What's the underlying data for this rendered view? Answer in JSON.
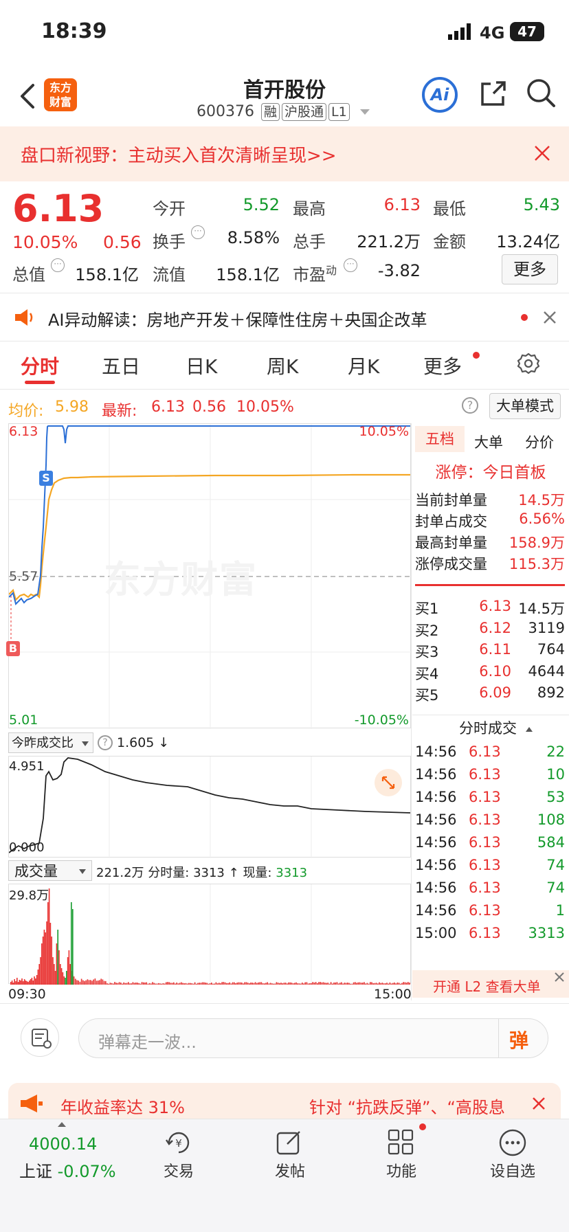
{
  "status_bar": {
    "time": "18:39",
    "network": "4G",
    "battery": "47"
  },
  "header": {
    "title": "首开股份",
    "code": "600376",
    "tags": [
      "融",
      "沪股通",
      "L1"
    ],
    "logo_line1": "东方",
    "logo_line2": "财富",
    "ai_label": "Ai"
  },
  "banner": {
    "text": "盘口新视野：主动买入首次清晰呈现>>"
  },
  "quote": {
    "price": "6.13",
    "pct": "10.05%",
    "change": "0.56",
    "rows": [
      [
        {
          "label": "今开",
          "value": "5.52",
          "color": "green"
        },
        {
          "label": "最高",
          "value": "6.13",
          "color": "red"
        },
        {
          "label": "最低",
          "value": "5.43",
          "color": "green"
        }
      ],
      [
        {
          "label": "换手",
          "value": "8.58%",
          "color": "dark"
        },
        {
          "label": "总手",
          "value": "221.2万",
          "color": "dark"
        },
        {
          "label": "金额",
          "value": "13.24亿",
          "color": "dark"
        }
      ],
      [
        {
          "label": "总值",
          "value": "158.1亿",
          "color": "dark"
        },
        {
          "label": "流值",
          "value": "158.1亿",
          "color": "dark"
        },
        {
          "label": "市盈",
          "sup": "动",
          "value": "-3.82",
          "color": "dark"
        }
      ]
    ],
    "more_button": "更多"
  },
  "ai_news": {
    "text": "AI异动解读：房地产开发＋保障性住房＋央国企改革"
  },
  "tabs": [
    "分时",
    "五日",
    "日K",
    "周K",
    "月K",
    "更多"
  ],
  "chart_header": {
    "avg_label": "均价:",
    "avg_value": "5.98",
    "latest_label": "最新:",
    "latest_value": "6.13",
    "latest_change": "0.56",
    "latest_pct": "10.05%",
    "big_order_button": "大单模式"
  },
  "price_chart": {
    "y_top": "6.13",
    "y_mid": "5.57",
    "y_bottom": "5.01",
    "pct_top": "10.05%",
    "pct_bottom": "-10.05%",
    "watermark": "东方财富",
    "marker_s": "S",
    "marker_b": "B"
  },
  "ratio_chart": {
    "dropdown": "今昨成交比",
    "value": "1.605 ↓",
    "y_top": "4.951",
    "y_bottom": "0.000"
  },
  "volume_chart": {
    "dropdown": "成交量",
    "total_label": "221.2万",
    "interval_label": "分时量:",
    "interval_value": "3313 ↑",
    "current_label": "现量:",
    "current_value": "3313",
    "y_top": "29.8万",
    "time_start": "09:30",
    "time_end": "15:00"
  },
  "side_panel": {
    "tabs": [
      "五档",
      "大单",
      "分价"
    ],
    "limit_up_text": "涨停：今日首板",
    "stats": [
      {
        "label": "当前封单量",
        "value": "14.5万"
      },
      {
        "label": "封单占成交",
        "value": "6.56%"
      },
      {
        "label": "最高封单量",
        "value": "158.9万"
      },
      {
        "label": "涨停成交量",
        "value": "115.3万"
      }
    ],
    "bids": [
      {
        "label": "买1",
        "price": "6.13",
        "volume": "14.5万"
      },
      {
        "label": "买2",
        "price": "6.12",
        "volume": "3119"
      },
      {
        "label": "买3",
        "price": "6.11",
        "volume": "764"
      },
      {
        "label": "买4",
        "price": "6.10",
        "volume": "4644"
      },
      {
        "label": "买5",
        "price": "6.09",
        "volume": "892"
      }
    ],
    "trades_title": "分时成交",
    "trades": [
      {
        "time": "14:56",
        "price": "6.13",
        "volume": "22"
      },
      {
        "time": "14:56",
        "price": "6.13",
        "volume": "10"
      },
      {
        "time": "14:56",
        "price": "6.13",
        "volume": "53"
      },
      {
        "time": "14:56",
        "price": "6.13",
        "volume": "108"
      },
      {
        "time": "14:56",
        "price": "6.13",
        "volume": "584"
      },
      {
        "time": "14:56",
        "price": "6.13",
        "volume": "74"
      },
      {
        "time": "14:56",
        "price": "6.13",
        "volume": "74"
      },
      {
        "time": "14:56",
        "price": "6.13",
        "volume": "1"
      },
      {
        "time": "15:00",
        "price": "6.13",
        "volume": "3313"
      }
    ],
    "l2_promo": "开通 L2 查看大单"
  },
  "comment_bar": {
    "placeholder": "弹幕走一波...",
    "danmu_label": "弹"
  },
  "promo_banner": {
    "left_text": "年收益率达 31%",
    "right_text": "针对 “抗跌反弹”、“高股息"
  },
  "bottom_nav": {
    "index_value": "4000.14",
    "index_label": "上证",
    "index_change": "-0.07%",
    "items": [
      "交易",
      "发帖",
      "功能",
      "设自选"
    ]
  },
  "colors": {
    "red": "#e8302f",
    "green": "#139a2b",
    "blue": "#2b6fd6",
    "orange": "#f4a623",
    "accent_orange": "#f5600f"
  }
}
